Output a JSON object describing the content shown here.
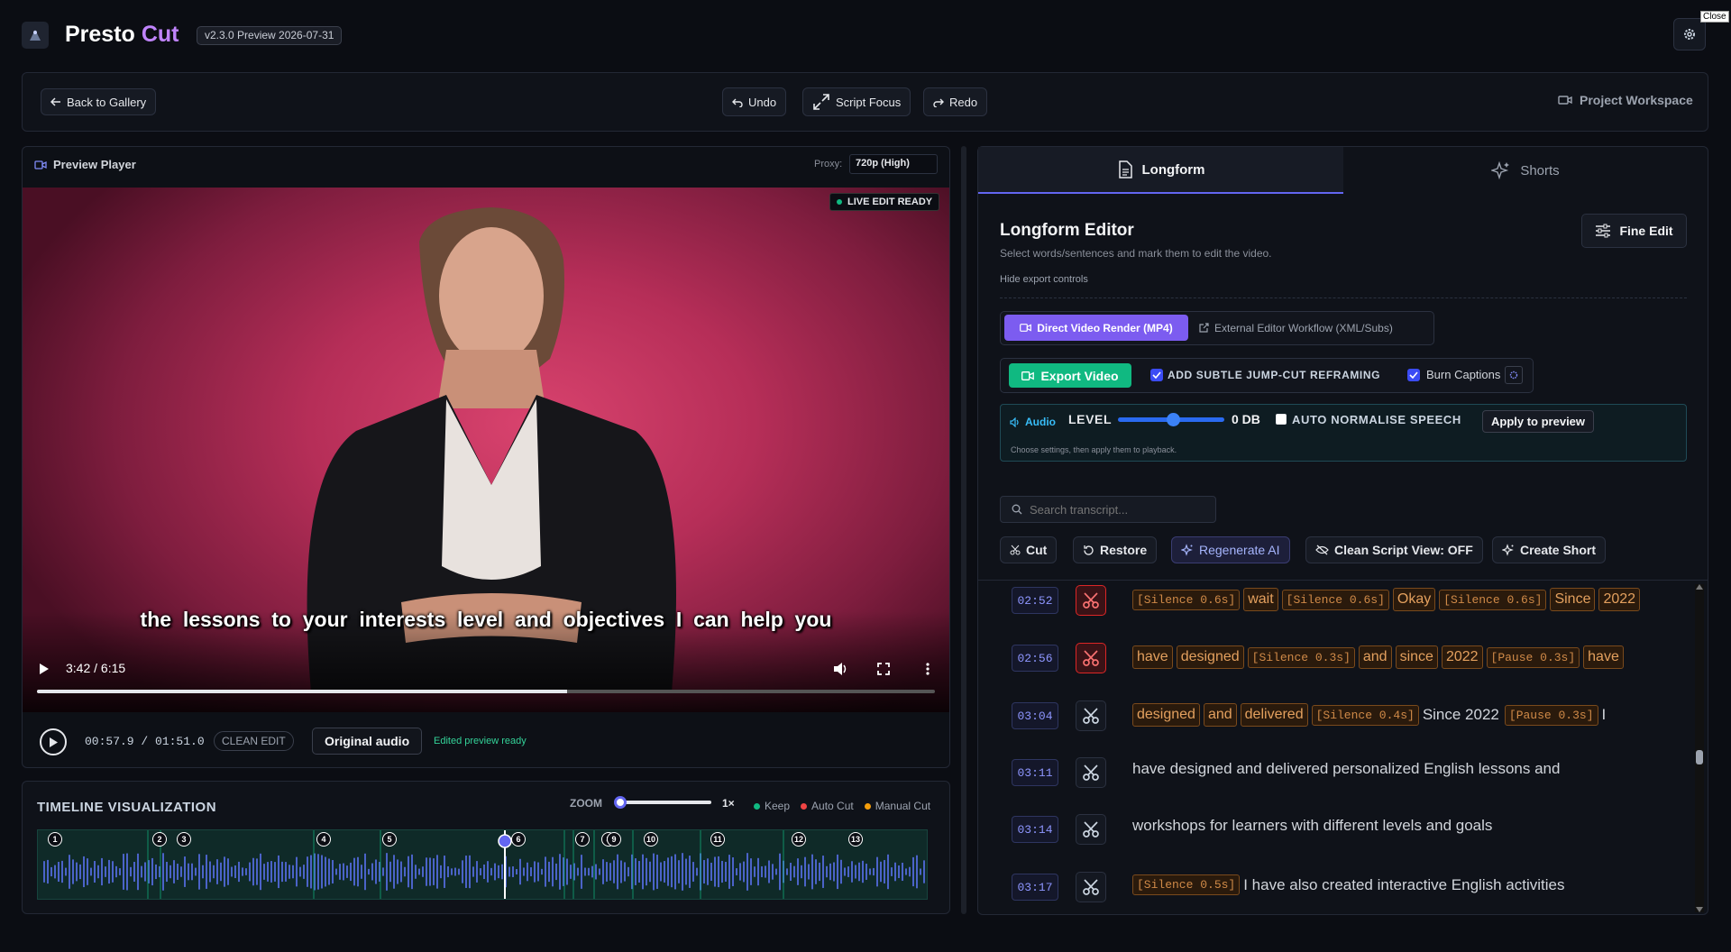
{
  "app": {
    "name_a": "Presto",
    "name_b": "Cut",
    "version": "v2.3.0 Preview 2026-07-31",
    "close_tooltip": "Close"
  },
  "toolbar": {
    "back": "Back to Gallery",
    "undo": "Undo",
    "script_focus": "Script Focus",
    "redo": "Redo",
    "workspace": "Project Workspace"
  },
  "player": {
    "title": "Preview Player",
    "proxy_label": "Proxy:",
    "proxy_value": "720p (High)",
    "live": "LIVE EDIT READY",
    "caption": "the  lessons  to  your  interests  level  and  objectives  I  can  help  you",
    "time": "3:42 / 6:15",
    "progress": 0.59,
    "edit_time": "00:57.9 / 01:51.0",
    "clean_edit": "CLEAN EDIT",
    "original_audio": "Original audio",
    "edited_ready": "Edited preview ready"
  },
  "timeline": {
    "title": "TIMELINE VISUALIZATION",
    "zoom_label": "ZOOM",
    "zoom_value": "1×",
    "legend": [
      "Keep",
      "Auto Cut",
      "Manual Cut"
    ],
    "markers": [
      "1",
      "2",
      "3",
      "4",
      "5",
      "6",
      "7",
      "8",
      "9",
      "10",
      "11",
      "12",
      "13"
    ],
    "colors": {
      "keep": "#10b981",
      "auto": "#ef4444",
      "manual": "#f59e0b"
    }
  },
  "tabs": {
    "longform": "Longform",
    "shorts": "Shorts"
  },
  "editor": {
    "title": "Longform Editor",
    "subtitle": "Select words/sentences and mark them to edit the video.",
    "fine_edit": "Fine Edit",
    "hide_export": "Hide export controls",
    "render_tab": "Direct Video Render (MP4)",
    "external_tab": "External Editor Workflow (XML/Subs)",
    "export_btn": "Export Video",
    "jumpcut": "ADD SUBTLE JUMP-CUT REFRAMING",
    "burn": "Burn Captions",
    "audio": "Audio",
    "level": "LEVEL",
    "level_value": "0 DB",
    "normalise": "AUTO NORMALISE SPEECH",
    "apply": "Apply to preview",
    "hint": "Choose settings, then apply them to playback.",
    "search_placeholder": "Search transcript...",
    "cut": "Cut",
    "restore": "Restore",
    "regenerate": "Regenerate AI",
    "clean_view": "Clean Script View: OFF",
    "create_short": "Create Short"
  },
  "transcript": [
    {
      "ts": "02:52",
      "partial": true,
      "cut": true,
      "tokens": [
        [
          "s",
          "[Silence 0.6s]"
        ],
        [
          "w",
          "wait"
        ],
        [
          "s",
          "[Silence 0.6s]"
        ],
        [
          "w",
          "Okay"
        ],
        [
          "s",
          "[Silence 0.6s]"
        ],
        [
          "w",
          "Since"
        ],
        [
          "w",
          "2022"
        ]
      ]
    },
    {
      "ts": "02:56",
      "cut": true,
      "tokens": [
        [
          "w",
          "have"
        ],
        [
          "w",
          "designed"
        ],
        [
          "s",
          "[Silence 0.3s]"
        ],
        [
          "w",
          "and"
        ],
        [
          "w",
          "since"
        ],
        [
          "w",
          "2022"
        ],
        [
          "s",
          "[Pause 0.3s]"
        ],
        [
          "w",
          "have"
        ]
      ]
    },
    {
      "ts": "03:04",
      "cut": false,
      "tokens": [
        [
          "w",
          "designed"
        ],
        [
          "w",
          "and"
        ],
        [
          "w",
          "delivered"
        ],
        [
          "s",
          "[Silence 0.4s]"
        ],
        [
          "t",
          "Since 2022"
        ],
        [
          "s",
          "[Pause 0.3s]"
        ],
        [
          "t",
          "I"
        ]
      ]
    },
    {
      "ts": "03:11",
      "cut": false,
      "tokens": [
        [
          "t",
          "have designed and delivered personalized English lessons and"
        ]
      ]
    },
    {
      "ts": "03:14",
      "cut": false,
      "tokens": [
        [
          "t",
          "workshops for learners with different levels and goals"
        ]
      ]
    },
    {
      "ts": "03:17",
      "cut": false,
      "tokens": [
        [
          "s",
          "[Silence 0.5s]"
        ],
        [
          "t",
          "I have also created interactive English activities"
        ]
      ]
    }
  ]
}
